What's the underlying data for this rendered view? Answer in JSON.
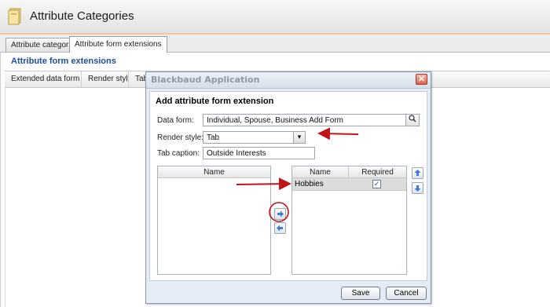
{
  "header": {
    "title": "Attribute Categories",
    "icon": "folder-icon"
  },
  "tabs": [
    {
      "label": "Attribute categories",
      "active": false
    },
    {
      "label": "Attribute form extensions",
      "active": true
    }
  ],
  "section": {
    "title": "Attribute form extensions",
    "columns": [
      "Extended data form",
      "Render style",
      "Tab capt"
    ]
  },
  "dialog": {
    "title": "Blackbaud Application",
    "heading": "Add attribute form extension",
    "fields": {
      "data_form": {
        "label": "Data form:",
        "value": "Individual, Spouse, Business Add Form"
      },
      "render_style": {
        "label": "Render style:",
        "value": "Tab"
      },
      "tab_caption": {
        "label": "Tab caption:",
        "value": "Outside Interests"
      }
    },
    "available": {
      "header": "Name",
      "items": []
    },
    "selected": {
      "headers": {
        "name": "Name",
        "required": "Required"
      },
      "rows": [
        {
          "name": "Hobbies",
          "required": true,
          "required_mark": "✓"
        }
      ]
    },
    "buttons": {
      "save": "Save",
      "cancel": "Cancel"
    }
  },
  "colors": {
    "accent": "#1a4fa3",
    "annotation": "#c0141b"
  }
}
